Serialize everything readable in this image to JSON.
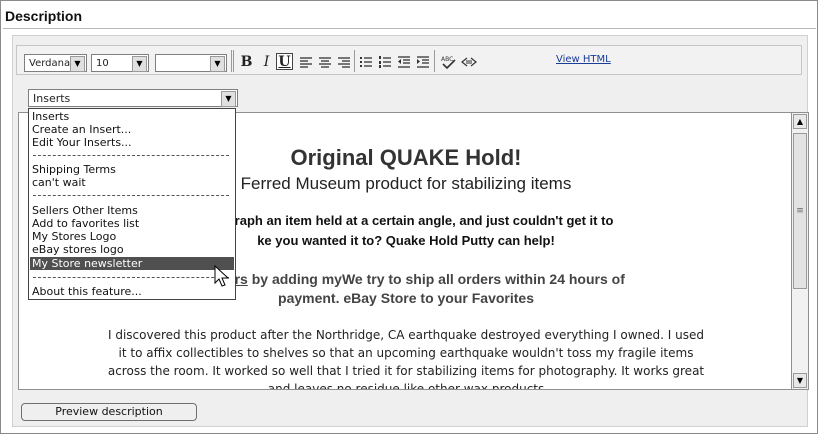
{
  "section": {
    "title": "Description"
  },
  "toolbar": {
    "font_family": "Verdana",
    "font_size": "10",
    "font_color": "",
    "bold_label": "B",
    "italic_label": "I",
    "underline_label": "U",
    "view_html": "View HTML",
    "icons": [
      "align-left-icon",
      "align-center-icon",
      "align-right-icon",
      "bulleted-list-icon",
      "numbered-list-icon",
      "outdent-icon",
      "indent-icon",
      "spellcheck-icon",
      "code-icon"
    ]
  },
  "inserts_select": {
    "value": "Inserts"
  },
  "inserts_menu": {
    "items": [
      "Inserts",
      "Create an Insert...",
      "Edit Your Inserts...",
      "Shipping Terms",
      "can't wait",
      "Sellers Other Items",
      "Add to favorites list",
      "My Stores Logo",
      "eBay stores logo",
      "My Store newsletter",
      "About this feature..."
    ],
    "selected": "My Store newsletter"
  },
  "content": {
    "heading": "Original QUAKE Hold!",
    "subheading": "Ferred Museum product for stabilizing items",
    "para1_line1": "hotograph an item held at a certain angle, and just couldn't get it to",
    "para1_line2": "ke you wanted it to? Quake Hold Putty can help!",
    "para2_link": "wsletters",
    "para2_rest": " by adding myWe try to ship all orders within 24 hours of",
    "para2_line2": "payment. eBay Store to your Favorites",
    "body_line1": "I discovered this product after the Northridge, CA earthquake destroyed everything I owned. I used",
    "body_line2": "it to affix collectibles to shelves so that an upcoming earthquake wouldn't toss my fragile items",
    "body_line3": "across the room. It worked so well that I tried it for stabilizing items for photography. It works great",
    "body_line4": "and leaves no residue like other wax products"
  },
  "preview_button": {
    "label": "Preview description"
  }
}
